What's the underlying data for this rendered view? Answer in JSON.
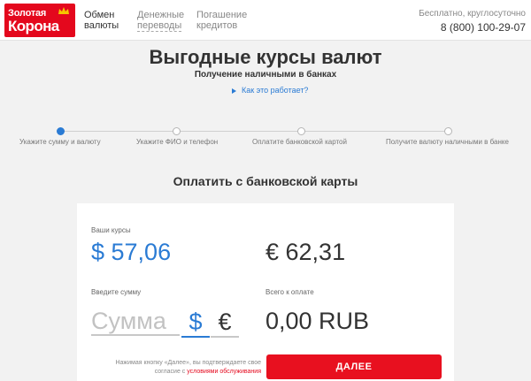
{
  "logo": {
    "line1": "Золотая",
    "line2": "Корона"
  },
  "nav": {
    "exchange": [
      "Обмен",
      "валюты"
    ],
    "transfers": [
      "Денежные",
      "переводы"
    ],
    "repayment": [
      "Погашение",
      "кредитов"
    ]
  },
  "contact": {
    "subtitle": "Бесплатно, круглосуточно",
    "phone": "8 (800) 100-29-07"
  },
  "hero": {
    "title": "Выгодные курсы валют",
    "subtitle": "Получение наличными в банках",
    "how_link": "Как это работает?"
  },
  "steps": [
    {
      "label": "Укажите сумму и валюту",
      "active": true
    },
    {
      "label": "Укажите ФИО и телефон",
      "active": false
    },
    {
      "label": "Оплатите банковской картой",
      "active": false
    },
    {
      "label": "Получите валюту наличными в банке",
      "active": false
    }
  ],
  "section_title": "Оплатить с банковской карты",
  "rates": {
    "label": "Ваши курсы",
    "usd": "$ 57,06",
    "eur": "€ 62,31"
  },
  "amount": {
    "label": "Введите сумму",
    "placeholder": "Сумма",
    "value": "",
    "currency_usd": "$",
    "currency_eur": "€",
    "selected_currency": "usd"
  },
  "total": {
    "label": "Всего к оплате",
    "value": "0,00 RUB"
  },
  "disclaimer": {
    "text": "Нажимая кнопку «Далее», вы подтверждаете свое согласие с",
    "link": "условиями обслуживания"
  },
  "next_button": "ДАЛЕЕ",
  "colors": {
    "brand_red": "#e4081d",
    "accent_blue": "#2a7bd4"
  }
}
